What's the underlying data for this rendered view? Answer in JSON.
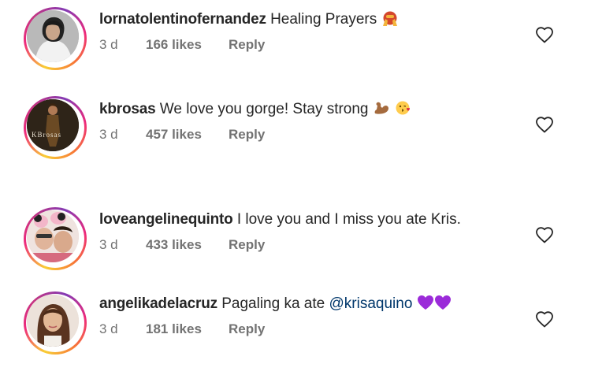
{
  "comments": [
    {
      "username": "lornatolentinofernandez",
      "text": "Healing Prayers",
      "emoji": "face-palm-emoji",
      "time": "3 d",
      "likes": "166 likes",
      "reply": "Reply"
    },
    {
      "username": "kbrosas",
      "text": "We love you gorge! Stay strong",
      "emoji": "flexed-biceps-and-kiss-emoji",
      "avatar_logo": "KBrosas",
      "time": "3 d",
      "likes": "457 likes",
      "reply": "Reply"
    },
    {
      "username": "loveangelinequinto",
      "text": "I love you and I miss you ate Kris.",
      "time": "3 d",
      "likes": "433 likes",
      "reply": "Reply"
    },
    {
      "username": "angelikadelacruz",
      "text": "Pagaling ka ate",
      "mention": "@krisaquino",
      "emoji": "purple-hearts-emoji",
      "time": "3 d",
      "likes": "181 likes",
      "reply": "Reply"
    }
  ],
  "colors": {
    "text": "#262626",
    "meta": "#737373",
    "mention": "#00376b",
    "purple_heart": "#9b2bd9"
  }
}
